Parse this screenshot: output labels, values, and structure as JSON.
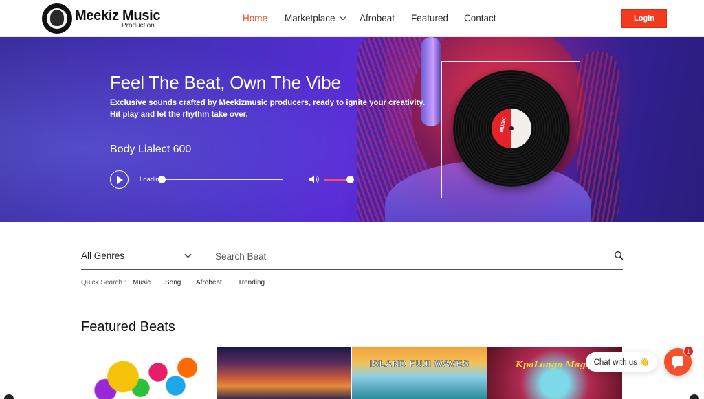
{
  "header": {
    "brand_name": "Meekiz Music",
    "brand_sub": "Production",
    "nav": [
      "Home",
      "Marketplace",
      "Afrobeat",
      "Featured",
      "Contact"
    ],
    "active_nav": "Home",
    "login_label": "Login"
  },
  "hero": {
    "title": "Feel The Beat, Own The Vibe",
    "description_line1": "Exclusive sounds crafted by Meekizmusic producers, ready to ignite your creativity.",
    "description_line2": "Hit play and let the rhythm take over.",
    "track_name": "Body Lialect 600",
    "status_text": "Loadin",
    "progress": 0,
    "volume": 0.85,
    "vinyl_label": "MUSIC"
  },
  "search": {
    "genre_selected": "All Genres",
    "placeholder": "Search Beat",
    "quick_search_label": "Quick Search :",
    "quick_links": [
      "Music",
      "Song",
      "Afrobeat",
      "Trending"
    ]
  },
  "featured": {
    "title": "Featured Beats",
    "cards": [
      {
        "title": ""
      },
      {
        "title": ""
      },
      {
        "title": "ISLAND FUJI WAVES"
      },
      {
        "title": "KpaLongo Magic"
      }
    ]
  },
  "chat": {
    "bubble_text": "Chat with us 👋",
    "badge_count": "1"
  },
  "colors": {
    "accent": "#ef4423",
    "login_bg": "#f23b1e",
    "chat_bg": "#f4502b"
  }
}
